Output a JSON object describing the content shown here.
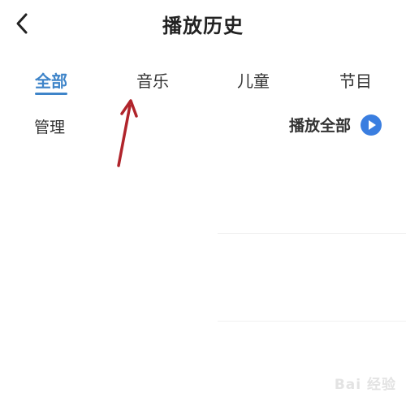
{
  "header": {
    "title": "播放历史",
    "back_icon": "chevron-left-icon"
  },
  "tabs": [
    {
      "label": "全部",
      "active": true
    },
    {
      "label": "音乐",
      "active": false
    },
    {
      "label": "儿童",
      "active": false
    },
    {
      "label": "节目",
      "active": false
    }
  ],
  "toolbar": {
    "manage_label": "管理",
    "play_all_label": "播放全部",
    "play_icon": "play-circle-icon"
  },
  "watermark": {
    "text": "Bai 经验"
  },
  "colors": {
    "accent": "#3e84c9",
    "play_button": "#3a7ee0",
    "annotation_arrow": "#b0242b"
  }
}
